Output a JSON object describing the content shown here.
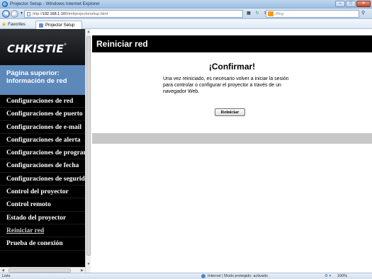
{
  "window": {
    "title": "Projector Setup - Windows Internet Explorer",
    "buttons": {
      "minimize": "–",
      "maximize": "□",
      "close": "✕"
    }
  },
  "addressbar": {
    "url_prefix": "http://",
    "url_host": "192.168.1.10",
    "url_path": "/html/projectorsetup.html",
    "search_placeholder": "Bing"
  },
  "favorites": {
    "favorites_label": "Favorites",
    "tab_label": "Projector Setup"
  },
  "sidebar": {
    "logo": "CHKISTIE",
    "top_page": "Página superior: Información de red",
    "items": [
      {
        "label": "Configuraciones de red",
        "active": false
      },
      {
        "label": "Configuraciones de puerto",
        "active": false
      },
      {
        "label": "Configuraciones de e-mail",
        "active": false
      },
      {
        "label": "Configuraciones de alerta",
        "active": false
      },
      {
        "label": "Configuraciones de programa",
        "active": false
      },
      {
        "label": "Configuraciones de fecha",
        "active": false
      },
      {
        "label": "Configuraciones de seguridad",
        "active": false
      },
      {
        "label": "Control del proyector",
        "active": false
      },
      {
        "label": "Control remoto",
        "active": false
      },
      {
        "label": "Estado del proyector",
        "active": false
      },
      {
        "label": "Reiniciar red",
        "active": true
      },
      {
        "label": "Prueba de conexión",
        "active": false
      }
    ]
  },
  "main": {
    "header": "Reiniciar red",
    "confirm_title": "¡Confirmar!",
    "message": "Una vez reiniciado, es necesario volver a iniciar la sesión para controlar o configurar el proyector a través de un navegador Web.",
    "restart_button": "Reiniciar"
  },
  "statusbar": {
    "left": "Listo",
    "zone": "Internet | Modo protegido: activado",
    "security": "⚙ ▾",
    "zoom": "100%"
  },
  "colors": {
    "sidebar_bg": "#000000",
    "top_page_bg": "#5d88ba",
    "header_bg": "#000000",
    "band": "#c8c8c8"
  }
}
